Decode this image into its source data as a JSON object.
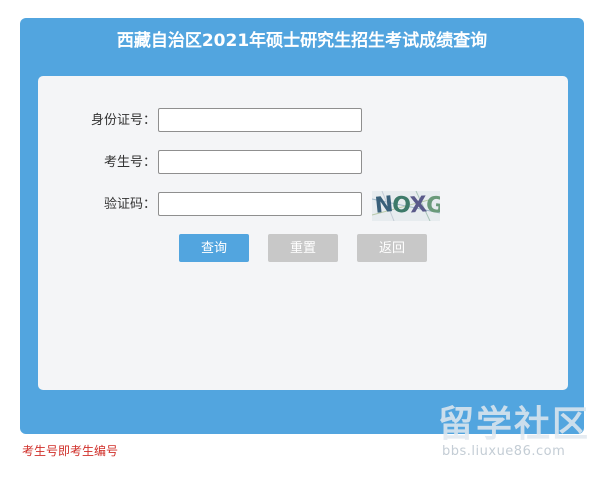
{
  "header": {
    "title": "西藏自治区2021年硕士研究生招生考试成绩查询"
  },
  "form": {
    "id_label": "身份证号：",
    "id_value": "",
    "exam_no_label": "考生号：",
    "exam_no_value": "",
    "captcha_label": "验证码：",
    "captcha_value": "",
    "captcha_chars": [
      "N",
      "O",
      "X",
      "G"
    ]
  },
  "buttons": {
    "query": "查询",
    "reset": "重置",
    "back": "返回"
  },
  "footer_note": "考生号即考生编号",
  "watermark": {
    "main": "留学社区",
    "sub": "bbs.liuxue86.com"
  },
  "colors": {
    "accent": "#52a5df",
    "form_bg": "#f4f5f7",
    "secondary_button": "#c8c8c8",
    "note_text": "#d0302a"
  }
}
